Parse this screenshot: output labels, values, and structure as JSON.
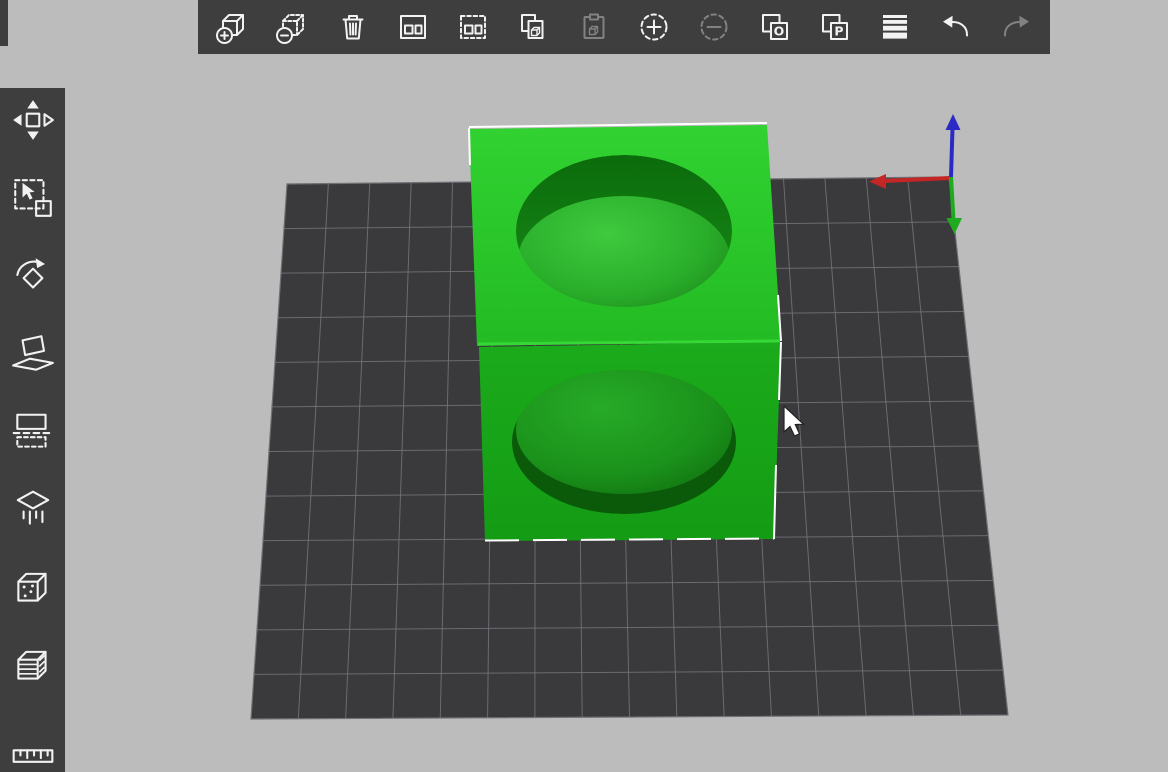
{
  "app": {
    "type": "3d-slicer-viewport"
  },
  "top_toolbar": {
    "icons": [
      {
        "name": "add-object",
        "enabled": true
      },
      {
        "name": "delete-object",
        "enabled": true
      },
      {
        "name": "delete-all",
        "enabled": true
      },
      {
        "name": "arrange",
        "enabled": true
      },
      {
        "name": "arrange-selection",
        "enabled": true
      },
      {
        "name": "copy",
        "enabled": true
      },
      {
        "name": "paste",
        "enabled": false
      },
      {
        "name": "add-instance",
        "enabled": true
      },
      {
        "name": "remove-instance",
        "enabled": false
      },
      {
        "name": "split-to-objects",
        "label": "O",
        "enabled": true
      },
      {
        "name": "split-to-parts",
        "label": "P",
        "enabled": true
      },
      {
        "name": "variable-layer-height",
        "enabled": true
      },
      {
        "name": "undo",
        "enabled": true
      },
      {
        "name": "redo",
        "enabled": false
      }
    ]
  },
  "side_toolbar": {
    "icons": [
      {
        "name": "move"
      },
      {
        "name": "scale"
      },
      {
        "name": "rotate"
      },
      {
        "name": "place-on-face"
      },
      {
        "name": "cut"
      },
      {
        "name": "paint-on-supports"
      },
      {
        "name": "seam-painting"
      },
      {
        "name": "multimaterial-painting"
      },
      {
        "name": "measure"
      }
    ]
  },
  "viewport": {
    "objects": [
      {
        "name": "upper-cube-with-sphere-cavity",
        "color": "#2bc72b"
      },
      {
        "name": "lower-cube-with-sphere-cavity",
        "color": "#17a017"
      }
    ],
    "axes": {
      "x_color": "#c42525",
      "y_color": "#1faa1f",
      "z_color": "#2b2bc4"
    },
    "colors": {
      "background": "#bcbcbc",
      "toolbar": "#3e3e3e",
      "icon_enabled": "#f2f2f2",
      "icon_disabled": "#828282",
      "plate": "#3a3a3d",
      "grid_line": "#73737a",
      "highlight": "#ffffff"
    }
  }
}
